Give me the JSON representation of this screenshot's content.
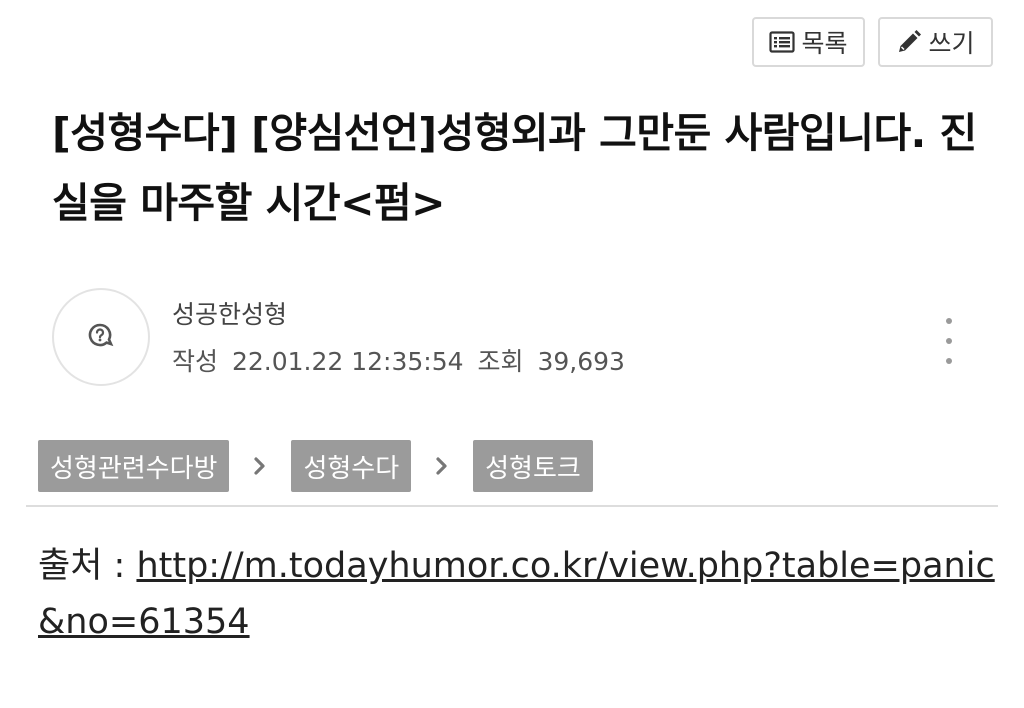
{
  "toolbar": {
    "list_label": "목록",
    "write_label": "쓰기",
    "list_icon": "list-icon",
    "write_icon": "pencil-icon"
  },
  "post": {
    "title": "[성형수다] [양심선언]성형외과 그만둔 사람입니다. 진실을 마주할 시간<펌>",
    "author": "성공한성형",
    "written_label": "작성",
    "date": "22.01.22 12:35:54",
    "views_label": "조회",
    "views": "39,693",
    "avatar_icon": "question-bubble-icon",
    "more_icon": "more-vertical-icon"
  },
  "breadcrumbs": [
    "성형관련수다방",
    "성형수다",
    "성형토크"
  ],
  "content": {
    "source_label": "출처 : ",
    "source_url": "http://m.todayhumor.co.kr/view.php?table=panic&no=61354"
  },
  "colors": {
    "crumb_bg": "#9b9b9b",
    "divider": "#dddddd",
    "button_border": "#d9d9d9"
  }
}
